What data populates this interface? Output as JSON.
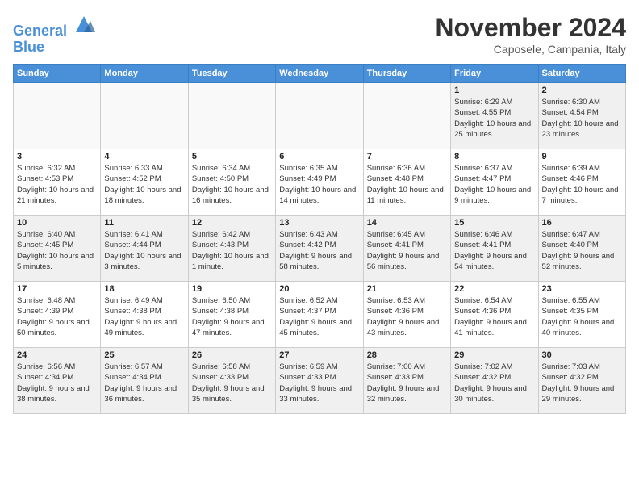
{
  "header": {
    "logo_line1": "General",
    "logo_line2": "Blue",
    "month_title": "November 2024",
    "subtitle": "Caposele, Campania, Italy"
  },
  "columns": [
    "Sunday",
    "Monday",
    "Tuesday",
    "Wednesday",
    "Thursday",
    "Friday",
    "Saturday"
  ],
  "weeks": [
    [
      {
        "day": "",
        "info": ""
      },
      {
        "day": "",
        "info": ""
      },
      {
        "day": "",
        "info": ""
      },
      {
        "day": "",
        "info": ""
      },
      {
        "day": "",
        "info": ""
      },
      {
        "day": "1",
        "info": "Sunrise: 6:29 AM\nSunset: 4:55 PM\nDaylight: 10 hours and 25 minutes."
      },
      {
        "day": "2",
        "info": "Sunrise: 6:30 AM\nSunset: 4:54 PM\nDaylight: 10 hours and 23 minutes."
      }
    ],
    [
      {
        "day": "3",
        "info": "Sunrise: 6:32 AM\nSunset: 4:53 PM\nDaylight: 10 hours and 21 minutes."
      },
      {
        "day": "4",
        "info": "Sunrise: 6:33 AM\nSunset: 4:52 PM\nDaylight: 10 hours and 18 minutes."
      },
      {
        "day": "5",
        "info": "Sunrise: 6:34 AM\nSunset: 4:50 PM\nDaylight: 10 hours and 16 minutes."
      },
      {
        "day": "6",
        "info": "Sunrise: 6:35 AM\nSunset: 4:49 PM\nDaylight: 10 hours and 14 minutes."
      },
      {
        "day": "7",
        "info": "Sunrise: 6:36 AM\nSunset: 4:48 PM\nDaylight: 10 hours and 11 minutes."
      },
      {
        "day": "8",
        "info": "Sunrise: 6:37 AM\nSunset: 4:47 PM\nDaylight: 10 hours and 9 minutes."
      },
      {
        "day": "9",
        "info": "Sunrise: 6:39 AM\nSunset: 4:46 PM\nDaylight: 10 hours and 7 minutes."
      }
    ],
    [
      {
        "day": "10",
        "info": "Sunrise: 6:40 AM\nSunset: 4:45 PM\nDaylight: 10 hours and 5 minutes."
      },
      {
        "day": "11",
        "info": "Sunrise: 6:41 AM\nSunset: 4:44 PM\nDaylight: 10 hours and 3 minutes."
      },
      {
        "day": "12",
        "info": "Sunrise: 6:42 AM\nSunset: 4:43 PM\nDaylight: 10 hours and 1 minute."
      },
      {
        "day": "13",
        "info": "Sunrise: 6:43 AM\nSunset: 4:42 PM\nDaylight: 9 hours and 58 minutes."
      },
      {
        "day": "14",
        "info": "Sunrise: 6:45 AM\nSunset: 4:41 PM\nDaylight: 9 hours and 56 minutes."
      },
      {
        "day": "15",
        "info": "Sunrise: 6:46 AM\nSunset: 4:41 PM\nDaylight: 9 hours and 54 minutes."
      },
      {
        "day": "16",
        "info": "Sunrise: 6:47 AM\nSunset: 4:40 PM\nDaylight: 9 hours and 52 minutes."
      }
    ],
    [
      {
        "day": "17",
        "info": "Sunrise: 6:48 AM\nSunset: 4:39 PM\nDaylight: 9 hours and 50 minutes."
      },
      {
        "day": "18",
        "info": "Sunrise: 6:49 AM\nSunset: 4:38 PM\nDaylight: 9 hours and 49 minutes."
      },
      {
        "day": "19",
        "info": "Sunrise: 6:50 AM\nSunset: 4:38 PM\nDaylight: 9 hours and 47 minutes."
      },
      {
        "day": "20",
        "info": "Sunrise: 6:52 AM\nSunset: 4:37 PM\nDaylight: 9 hours and 45 minutes."
      },
      {
        "day": "21",
        "info": "Sunrise: 6:53 AM\nSunset: 4:36 PM\nDaylight: 9 hours and 43 minutes."
      },
      {
        "day": "22",
        "info": "Sunrise: 6:54 AM\nSunset: 4:36 PM\nDaylight: 9 hours and 41 minutes."
      },
      {
        "day": "23",
        "info": "Sunrise: 6:55 AM\nSunset: 4:35 PM\nDaylight: 9 hours and 40 minutes."
      }
    ],
    [
      {
        "day": "24",
        "info": "Sunrise: 6:56 AM\nSunset: 4:34 PM\nDaylight: 9 hours and 38 minutes."
      },
      {
        "day": "25",
        "info": "Sunrise: 6:57 AM\nSunset: 4:34 PM\nDaylight: 9 hours and 36 minutes."
      },
      {
        "day": "26",
        "info": "Sunrise: 6:58 AM\nSunset: 4:33 PM\nDaylight: 9 hours and 35 minutes."
      },
      {
        "day": "27",
        "info": "Sunrise: 6:59 AM\nSunset: 4:33 PM\nDaylight: 9 hours and 33 minutes."
      },
      {
        "day": "28",
        "info": "Sunrise: 7:00 AM\nSunset: 4:33 PM\nDaylight: 9 hours and 32 minutes."
      },
      {
        "day": "29",
        "info": "Sunrise: 7:02 AM\nSunset: 4:32 PM\nDaylight: 9 hours and 30 minutes."
      },
      {
        "day": "30",
        "info": "Sunrise: 7:03 AM\nSunset: 4:32 PM\nDaylight: 9 hours and 29 minutes."
      }
    ]
  ]
}
